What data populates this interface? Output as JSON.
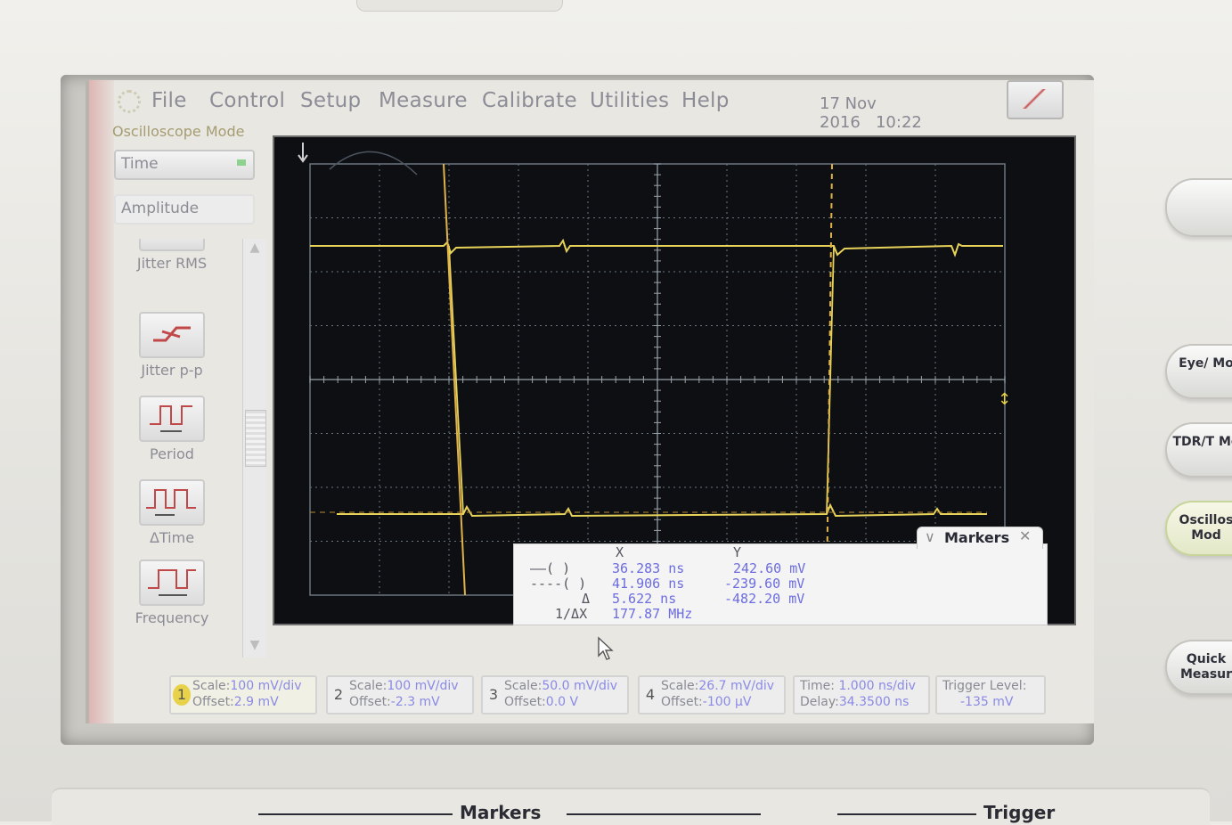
{
  "menu": {
    "items": [
      "File",
      "Control",
      "Setup",
      "Measure",
      "Calibrate",
      "Utilities",
      "Help"
    ],
    "date": "17 Nov 2016",
    "time": "10:22"
  },
  "mode_label": "Oscilloscope Mode",
  "side": {
    "time_select": "Time",
    "amplitude_select": "Amplitude",
    "tools": [
      "Jitter RMS",
      "Jitter p-p",
      "Period",
      "ΔTime",
      "Frequency"
    ]
  },
  "markers": {
    "title": "Markers",
    "col_x": "X",
    "col_y": "Y",
    "rows": [
      {
        "label": "——( )",
        "x": "36.283 ns",
        "y": "242.60 mV"
      },
      {
        "label": "----( )",
        "x": "41.906 ns",
        "y": "-239.60 mV"
      },
      {
        "label": "Δ",
        "x": "5.622 ns",
        "y": "-482.20 mV"
      },
      {
        "label": "1/ΔX",
        "x": "177.87 MHz",
        "y": ""
      }
    ]
  },
  "channels": [
    {
      "num": "1",
      "scale_key": "Scale:",
      "scale": "100 mV/div",
      "offset_key": "Offset:",
      "offset": "2.9 mV",
      "color": "#e7d24a"
    },
    {
      "num": "2",
      "scale_key": "Scale:",
      "scale": "100 mV/div",
      "offset_key": "Offset:",
      "offset": "-2.3 mV",
      "color": "#dcdcdc"
    },
    {
      "num": "3",
      "scale_key": "Scale:",
      "scale": "50.0 mV/div",
      "offset_key": "Offset:",
      "offset": "0.0 V",
      "color": "#dcdcdc"
    },
    {
      "num": "4",
      "scale_key": "Scale:",
      "scale": "26.7 mV/div",
      "offset_key": "Offset:",
      "offset": "-100 µV",
      "color": "#dcdcdc"
    }
  ],
  "timebase": {
    "time_key": "Time:",
    "time": "1.000 ns/div",
    "delay_key": "Delay:",
    "delay": "34.3500 ns"
  },
  "trigger": {
    "key": "Trigger Level:",
    "value": "-135 mV"
  },
  "hw_buttons": [
    "Eye/ Mo",
    "TDR/T Mo",
    "Oscillos Mod",
    "Quick Measur"
  ],
  "panel_labels": {
    "markers": "Markers",
    "trigger": "Trigger"
  },
  "colors": {
    "trace": "#e8d35a",
    "graticule": "#6b7580",
    "markers_value": "#6c6ce0"
  }
}
